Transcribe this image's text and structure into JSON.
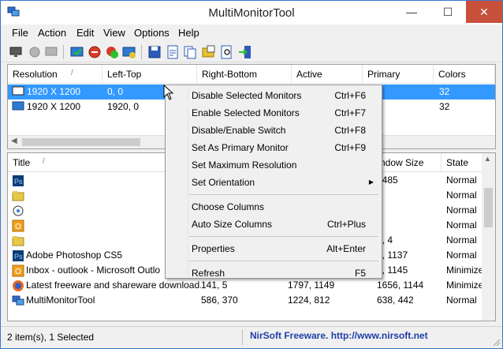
{
  "window": {
    "title": "MultiMonitorTool",
    "min": "—",
    "max": "☐",
    "close": "✕"
  },
  "menu": [
    "File",
    "Action",
    "Edit",
    "View",
    "Options",
    "Help"
  ],
  "monitors": {
    "columns": [
      "Resolution",
      "Left-Top",
      "Right-Bottom",
      "Active",
      "Primary",
      "Colors"
    ],
    "rows": [
      {
        "resolution": "1920 X 1200",
        "left_top": "0, 0",
        "colors": "32",
        "selected": true
      },
      {
        "resolution": "1920 X 1200",
        "left_top": "1920, 0",
        "colors": "32",
        "selected": false
      }
    ]
  },
  "windows": {
    "columns": [
      "Title",
      "ndow Size",
      "State"
    ],
    "rows": [
      {
        "icon": "photoshop-icon",
        "title": "",
        "c2": "",
        "c3": "",
        "size": ", 485",
        "state": "Normal"
      },
      {
        "icon": "folder-icon",
        "title": "",
        "c2": "",
        "c3": "",
        "size": "",
        "state": "Normal"
      },
      {
        "icon": "gear-app-icon",
        "title": "",
        "c2": "",
        "c3": "",
        "size": "",
        "state": "Normal"
      },
      {
        "icon": "outlook-icon",
        "title": "",
        "c2": "",
        "c3": "",
        "size": "",
        "state": "Normal"
      },
      {
        "icon": "folder-icon",
        "title": "",
        "c2": "",
        "c3": "",
        "size": "0, 4",
        "state": "Normal"
      },
      {
        "icon": "photoshop-icon",
        "title": "Adobe Photoshop CS5",
        "c2": "",
        "c3": "",
        "size": "6, 1137",
        "state": "Normal"
      },
      {
        "icon": "outlook-icon",
        "title": "Inbox - outlook - Microsoft Outlo",
        "c2": "",
        "c3": "",
        "size": "6, 1145",
        "state": "Minimize"
      },
      {
        "icon": "firefox-icon",
        "title": "Latest freeware and shareware download...",
        "c2": "141, 5",
        "c3": "1797, 1149",
        "size": "1656, 1144",
        "state": "Minimize"
      },
      {
        "icon": "multimonitor-icon",
        "title": "MultiMonitorTool",
        "c2": "586, 370",
        "c3": "1224, 812",
        "size": "638, 442",
        "state": "Normal"
      }
    ]
  },
  "context_menu": [
    {
      "label": "Disable Selected Monitors",
      "shortcut": "Ctrl+F6"
    },
    {
      "label": "Enable Selected Monitors",
      "shortcut": "Ctrl+F7"
    },
    {
      "label": "Disable/Enable Switch",
      "shortcut": "Ctrl+F8"
    },
    {
      "label": "Set As Primary Monitor",
      "shortcut": "Ctrl+F9"
    },
    {
      "label": "Set Maximum Resolution",
      "shortcut": ""
    },
    {
      "label": "Set Orientation",
      "shortcut": "",
      "submenu": "▶"
    },
    {
      "separator": true
    },
    {
      "label": "Choose Columns",
      "shortcut": ""
    },
    {
      "label": "Auto Size Columns",
      "shortcut": "Ctrl+Plus"
    },
    {
      "separator": true
    },
    {
      "label": "Properties",
      "shortcut": "Alt+Enter"
    },
    {
      "separator": true
    },
    {
      "label": "Refresh",
      "shortcut": "F5"
    }
  ],
  "status": {
    "left": "2 item(s), 1 Selected",
    "right": "NirSoft Freeware.  http://www.nirsoft.net"
  },
  "colors": {
    "selection": "#3399ff",
    "close_button": "#c7503b",
    "nirsoft_link": "#1f3fa8"
  }
}
